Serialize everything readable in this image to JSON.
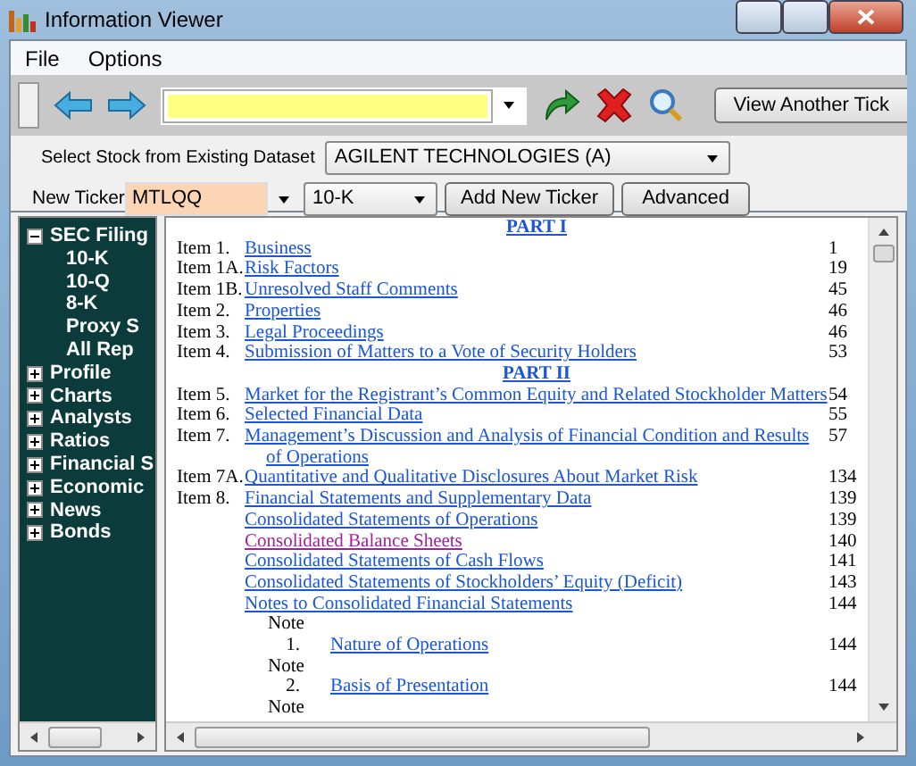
{
  "window": {
    "title": "Information Viewer"
  },
  "menu": [
    "File",
    "Options"
  ],
  "toolbar": {
    "view_button": "View Another Tick"
  },
  "selector": {
    "dataset_label": "Select Stock from Existing Dataset",
    "dataset_value": "AGILENT TECHNOLOGIES (A)",
    "ticker_label": "New Ticker",
    "ticker_value": "MTLQQ",
    "form_value": "10-K",
    "add_button": "Add New Ticker",
    "advanced_button": "Advanced"
  },
  "tree": [
    {
      "label": "SEC Filing",
      "expanded": true,
      "children": [
        {
          "label": "10-K"
        },
        {
          "label": "10-Q"
        },
        {
          "label": "8-K"
        },
        {
          "label": "Proxy S"
        },
        {
          "label": "All Rep"
        }
      ]
    },
    {
      "label": "Profile",
      "expanded": false
    },
    {
      "label": "Charts",
      "expanded": false
    },
    {
      "label": "Analysts",
      "expanded": false
    },
    {
      "label": "Ratios",
      "expanded": false
    },
    {
      "label": "Financial S",
      "expanded": false
    },
    {
      "label": "Economic",
      "expanded": false
    },
    {
      "label": "News",
      "expanded": false
    },
    {
      "label": "Bonds",
      "expanded": false
    }
  ],
  "document": {
    "rows": [
      {
        "kind": "part",
        "title": "PART I"
      },
      {
        "kind": "item",
        "label": "Item 1.",
        "title": "Business",
        "page": "1",
        "visited": false
      },
      {
        "kind": "item",
        "label": "Item 1A.",
        "title": "Risk Factors",
        "page": "19",
        "visited": false
      },
      {
        "kind": "item",
        "label": "Item 1B.",
        "title": "Unresolved Staff Comments",
        "page": "45",
        "visited": false
      },
      {
        "kind": "item",
        "label": "Item 2.",
        "title": "Properties",
        "page": "46",
        "visited": false
      },
      {
        "kind": "item",
        "label": "Item 3.",
        "title": "Legal Proceedings",
        "page": "46",
        "visited": false
      },
      {
        "kind": "item",
        "label": "Item 4.",
        "title": "Submission of Matters to a Vote of Security Holders",
        "page": "53",
        "visited": false
      },
      {
        "kind": "part",
        "title": "PART II"
      },
      {
        "kind": "item",
        "label": "Item 5.",
        "title": "Market for the Registrant’s Common Equity and Related Stockholder Matters",
        "page": "54",
        "visited": false
      },
      {
        "kind": "item",
        "label": "Item 6.",
        "title": "Selected Financial Data",
        "page": "55",
        "visited": false
      },
      {
        "kind": "item",
        "label": "Item 7.",
        "title": "Management’s Discussion and Analysis of Financial Condition and Results of Operations",
        "page": "57",
        "visited": false
      },
      {
        "kind": "item",
        "label": "Item 7A.",
        "title": "Quantitative and Qualitative Disclosures About Market Risk",
        "page": "134",
        "visited": false
      },
      {
        "kind": "item",
        "label": "Item 8.",
        "title": "Financial Statements and Supplementary Data",
        "page": "139",
        "visited": false
      },
      {
        "kind": "sub",
        "title": "Consolidated Statements of Operations",
        "page": "139",
        "visited": false
      },
      {
        "kind": "sub",
        "title": "Consolidated Balance Sheets",
        "page": "140",
        "visited": true
      },
      {
        "kind": "sub",
        "title": "Consolidated Statements of Cash Flows",
        "page": "141",
        "visited": false
      },
      {
        "kind": "sub",
        "title": "Consolidated Statements of Stockholders’ Equity (Deficit)",
        "page": "143",
        "visited": false
      },
      {
        "kind": "sub",
        "title": "Notes to Consolidated Financial Statements",
        "page": "144",
        "visited": false
      },
      {
        "kind": "note",
        "label": "Note"
      },
      {
        "kind": "note-item",
        "number": "1.",
        "title": "Nature of Operations",
        "page": "144",
        "visited": false
      },
      {
        "kind": "note",
        "label": "Note"
      },
      {
        "kind": "note-item",
        "number": "2.",
        "title": "Basis of Presentation",
        "page": "144",
        "visited": false
      },
      {
        "kind": "note",
        "label": "Note"
      }
    ]
  }
}
